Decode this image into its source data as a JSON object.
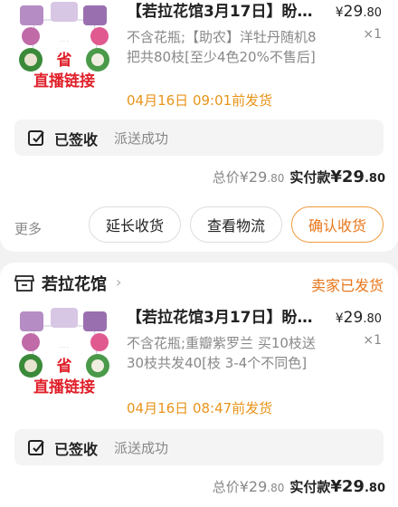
{
  "orders": [
    {
      "product": {
        "name": "【若拉花馆3月17日】盼盼...",
        "price": {
          "currency": "¥",
          "integer": "29",
          "decimal": ".80"
        },
        "spec": "不含花瓶;【助农】洋牡丹随机8把共80枝[至少4色20%不售后]",
        "quantity": "×1",
        "promise": "04月16日 09:01前发货"
      },
      "sign": {
        "title": "已签收",
        "desc": "派送成功"
      },
      "totals": {
        "label": "总价",
        "price": {
          "currency": "¥",
          "integer": "29",
          "decimal": ".80"
        },
        "paid_label": "实付款",
        "paid": {
          "currency": "¥",
          "integer": "29",
          "decimal": ".80"
        }
      },
      "actions": {
        "more": "更多",
        "extend": "延长收货",
        "logistics": "查看物流",
        "confirm": "确认收货"
      }
    },
    {
      "shop": {
        "name": "若拉花馆",
        "status": "卖家已发货"
      },
      "product": {
        "name": "【若拉花馆3月17日】盼盼...",
        "price": {
          "currency": "¥",
          "integer": "29",
          "decimal": ".80"
        },
        "spec": "不含花瓶;重瓣紫罗兰 买10枝送30枝共发40[枝 3-4个不同色]",
        "quantity": "×1",
        "promise": "04月16日 08:47前发货"
      },
      "sign": {
        "title": "已签收",
        "desc": "派送成功"
      },
      "totals": {
        "label": "总价",
        "price": {
          "currency": "¥",
          "integer": "29",
          "decimal": ".80"
        },
        "paid_label": "实付款",
        "paid": {
          "currency": "¥",
          "integer": "29",
          "decimal": ".80"
        }
      }
    }
  ],
  "thumbnail": {
    "province_text": "省",
    "live_text": "直播链接"
  },
  "colors": {
    "accent": "#e8761a",
    "promise": "#e8941a",
    "live_red": "#e0202a",
    "card": "#ffffff",
    "bg": "#f2f2f2"
  }
}
